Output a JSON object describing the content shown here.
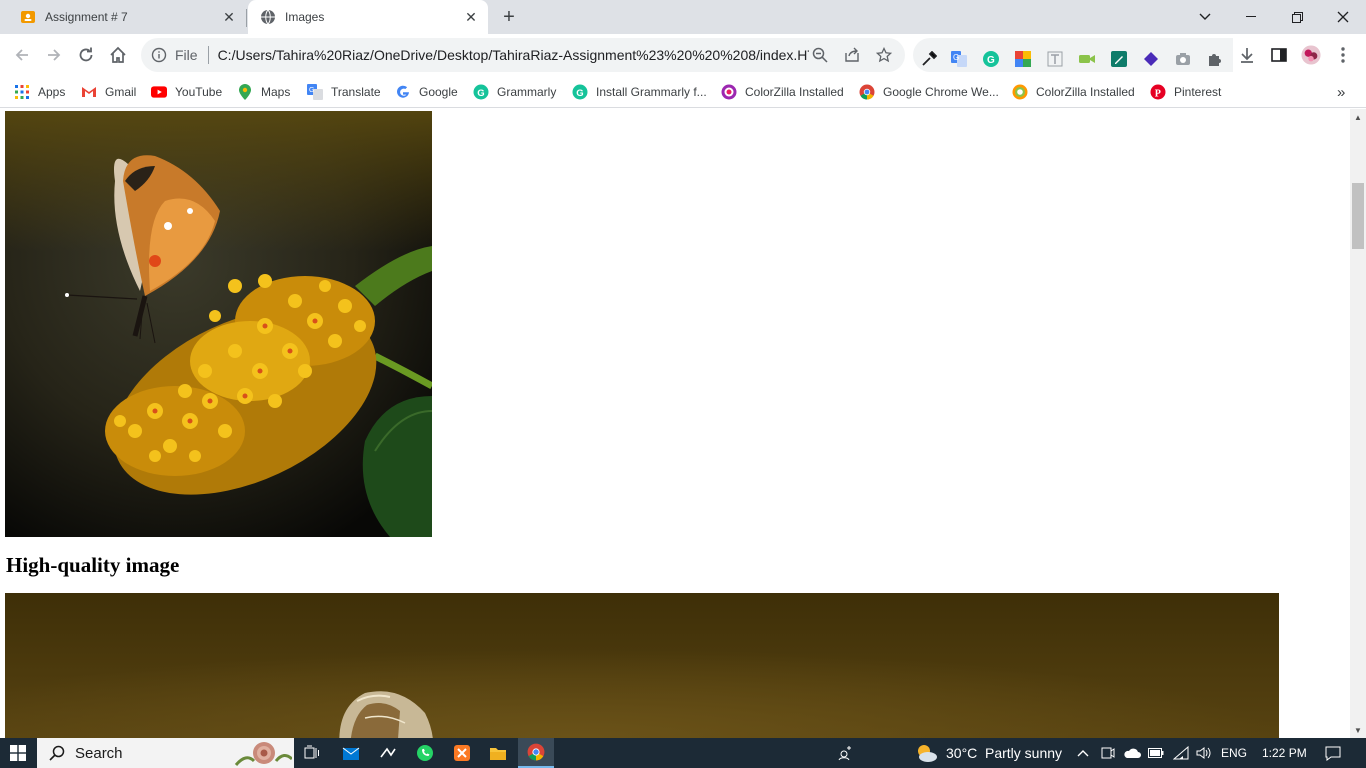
{
  "browser": {
    "tabs": [
      {
        "title": "Assignment # 7",
        "icon": "classroom-icon",
        "active": false
      },
      {
        "title": "Images",
        "icon": "globe-icon",
        "active": true
      }
    ],
    "new_tab": "+",
    "omnibox": {
      "scheme": "File",
      "url": "C:/Users/Tahira%20Riaz/OneDrive/Desktop/TahiraRiaz-Assignment%23%20%20%208/index.HT..."
    },
    "bookmarks": [
      {
        "label": "Apps",
        "icon": "apps-grid-icon"
      },
      {
        "label": "Gmail",
        "icon": "gmail-icon"
      },
      {
        "label": "YouTube",
        "icon": "youtube-icon"
      },
      {
        "label": "Maps",
        "icon": "maps-pin-icon"
      },
      {
        "label": "Translate",
        "icon": "translate-icon"
      },
      {
        "label": "Google",
        "icon": "google-icon"
      },
      {
        "label": "Grammarly",
        "icon": "grammarly-icon"
      },
      {
        "label": "Install Grammarly f...",
        "icon": "grammarly-icon"
      },
      {
        "label": "ColorZilla Installed",
        "icon": "colorzilla-icon"
      },
      {
        "label": "Google Chrome We...",
        "icon": "chrome-icon"
      },
      {
        "label": "ColorZilla Installed",
        "icon": "colorzilla-icon"
      },
      {
        "label": "Pinterest",
        "icon": "pinterest-icon"
      }
    ],
    "more_bookmarks": "»"
  },
  "page": {
    "caption": "High-quality image",
    "images": [
      {
        "subject": "butterfly on yellow flowers"
      },
      {
        "subject": "butterfly, high-quality"
      }
    ]
  },
  "taskbar": {
    "search_label": "Search",
    "weather": {
      "temp": "30°C",
      "condition": "Partly sunny"
    },
    "language": "ENG",
    "time": "1:22 PM"
  },
  "colors": {
    "tabstrip": "#dee1e6",
    "omnibox": "#f1f3f4",
    "taskbar": "#1c2a36"
  }
}
